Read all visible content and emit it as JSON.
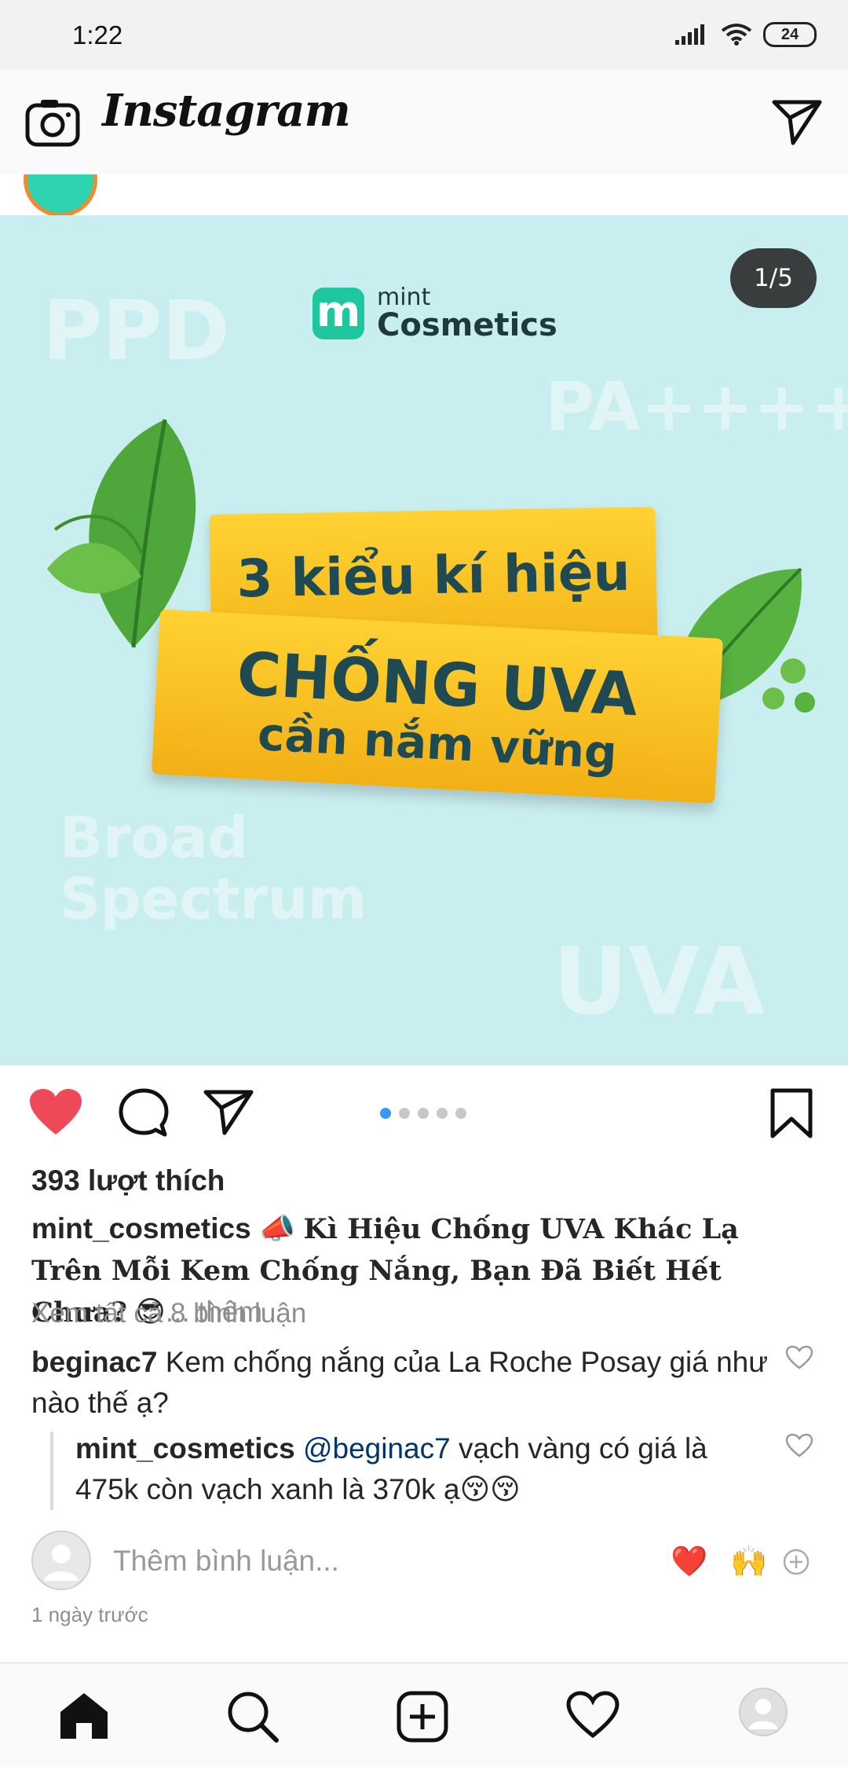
{
  "status_bar": {
    "time": "1:22",
    "battery": "24"
  },
  "header": {
    "app_name": "Instagram"
  },
  "post": {
    "page_indicator": "1/5",
    "image": {
      "brand_small": "mint",
      "brand_big": "Cosmetics",
      "bg_words": [
        "PPD",
        "PA++++",
        "Broad",
        "Spectrum",
        "UVA"
      ],
      "line1": "3 kiểu kí hiệu",
      "line2": "CHỐNG UVA",
      "line3": "cần nắm vững"
    },
    "carousel": {
      "count": 5,
      "active": 1
    },
    "likes": "393 lượt thích",
    "caption": {
      "user": "mint_cosmetics",
      "emoji_start": "📣",
      "text": "Kì Hiệu Chống UVA Khác Lạ Trên Mỗi Kem Chống Nắng, Bạn Đã Biết Hết Chưa?",
      "emoji_end": "😎",
      "more": "... thêm"
    },
    "view_all_comments": "Xem tất cả 8 bình luận",
    "comments": [
      {
        "user": "beginac7",
        "text": "Kem chống nắng của La Roche Posay giá như nào thế ạ?"
      },
      {
        "user": "mint_cosmetics",
        "mention": "@beginac7",
        "text": "vạch vàng có giá là 475k còn vạch xanh là 370k ạ😚😚"
      }
    ],
    "add_comment_placeholder": "Thêm bình luận...",
    "quick_emojis": [
      "❤️",
      "🙌"
    ],
    "time_ago": "1 ngày trước"
  },
  "colors": {
    "like_red": "#ed4956",
    "link_blue": "#3897f0",
    "mention": "#003569",
    "image_bg": "#c9eef0",
    "plank": "#f7c423"
  },
  "icons": [
    "camera-icon",
    "direct-message-icon",
    "heart-icon",
    "comment-icon",
    "share-icon",
    "bookmark-icon",
    "home-icon",
    "search-icon",
    "add-post-icon",
    "activity-heart-icon",
    "profile-icon"
  ]
}
